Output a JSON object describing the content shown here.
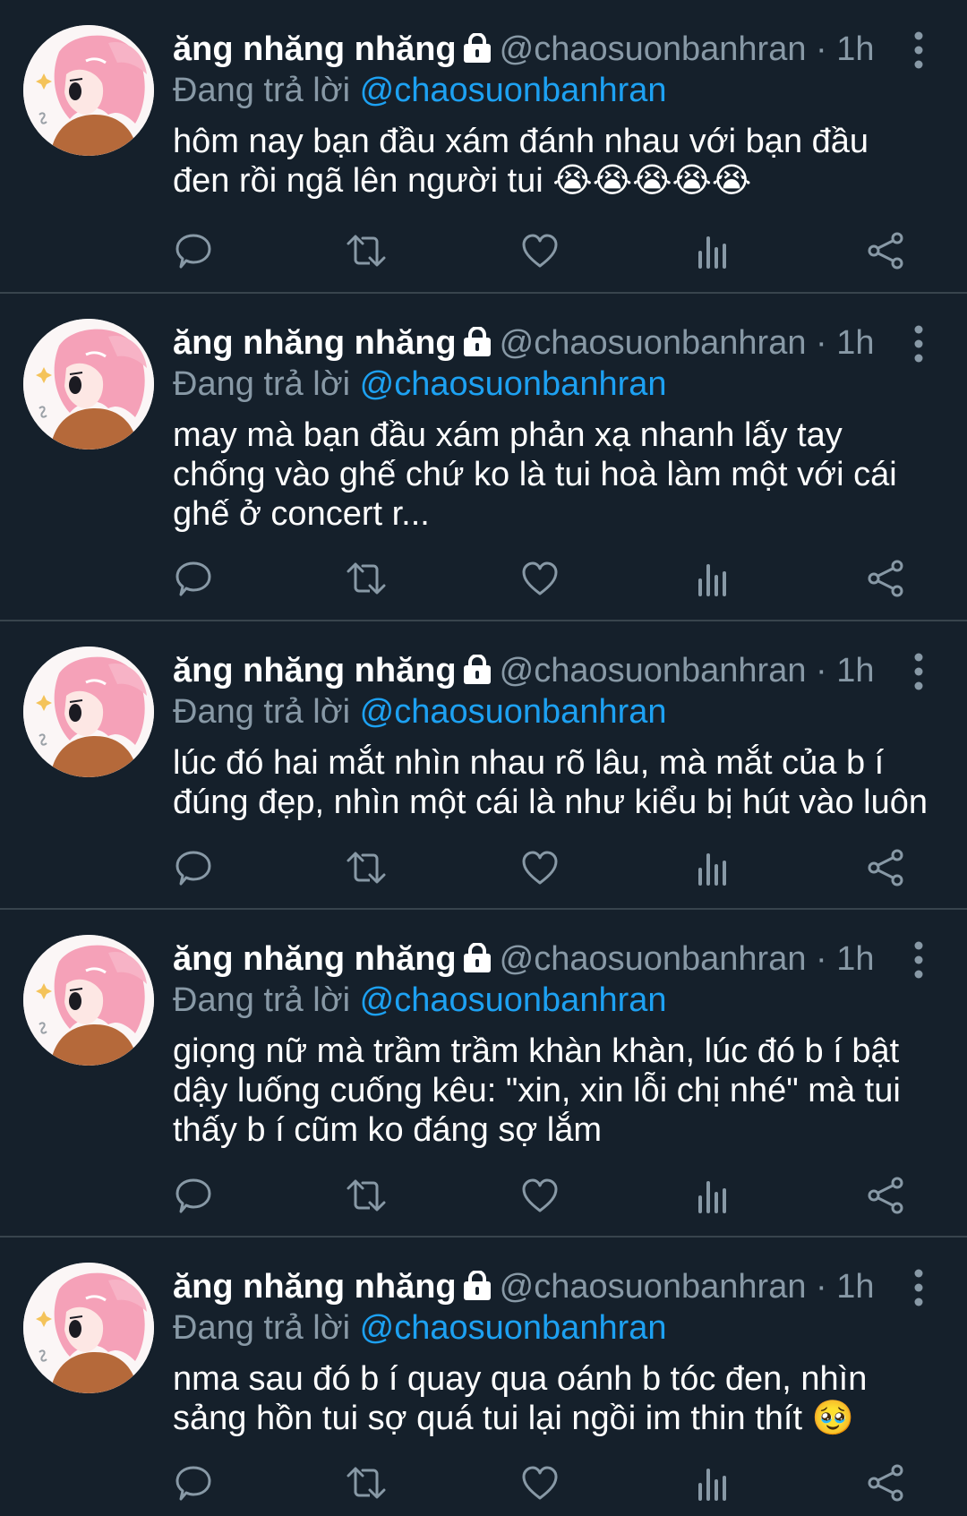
{
  "tweets": [
    {
      "name": "ăng nhăng nhăng",
      "handle": "@chaosuonbanhran",
      "time": "· 1h",
      "reply_prefix": "Đang trả lời",
      "reply_to": "@chaosuonbanhran",
      "lines": [
        "hôm nay bạn đầu xám đánh nhau với bạn đầu",
        "đen rồi ngã lên người tui 😭😭😭😭😭"
      ]
    },
    {
      "name": "ăng nhăng nhăng",
      "handle": "@chaosuonbanhran",
      "time": "· 1h",
      "reply_prefix": "Đang trả lời",
      "reply_to": "@chaosuonbanhran",
      "lines": [
        "may mà bạn đầu xám phản xạ nhanh lấy tay",
        "chống vào ghế chứ ko là tui hoà làm một với cái",
        "ghế ở concert r..."
      ]
    },
    {
      "name": "ăng nhăng nhăng",
      "handle": "@chaosuonbanhran",
      "time": "· 1h",
      "reply_prefix": "Đang trả lời",
      "reply_to": "@chaosuonbanhran",
      "lines": [
        "lúc đó hai mắt nhìn nhau rõ lâu, mà mắt của b í",
        "đúng đẹp, nhìn một cái là như kiểu bị hút vào luôn"
      ]
    },
    {
      "name": "ăng nhăng nhăng",
      "handle": "@chaosuonbanhran",
      "time": "· 1h",
      "reply_prefix": "Đang trả lời",
      "reply_to": "@chaosuonbanhran",
      "lines": [
        "giọng nữ mà trầm trầm khàn khàn, lúc đó b í bật",
        "dậy luống cuống kêu: \"xin, xin lỗi chị nhé\" mà tui",
        "thấy b í cũm ko đáng sợ lắm"
      ]
    },
    {
      "name": "ăng nhăng nhăng",
      "handle": "@chaosuonbanhran",
      "time": "· 1h",
      "reply_prefix": "Đang trả lời",
      "reply_to": "@chaosuonbanhran",
      "lines": [
        "nma sau đó b í quay qua oánh b tóc đen, nhìn",
        "sảng hồn tui sợ quá tui lại ngồi im thin thít 🥹"
      ]
    }
  ],
  "icons": {
    "avatar": "anime-girl-pink-hair-avatar",
    "lock": "lock-icon",
    "more": "more-vertical-icon",
    "actions": [
      "reply-icon",
      "retweet-icon",
      "like-icon",
      "analytics-icon",
      "share-icon"
    ]
  },
  "colors": {
    "background": "#15202b",
    "divider": "#38444d",
    "secondary_text": "#8899a6",
    "mention": "#1da1f2",
    "icon": "#8899a6"
  }
}
